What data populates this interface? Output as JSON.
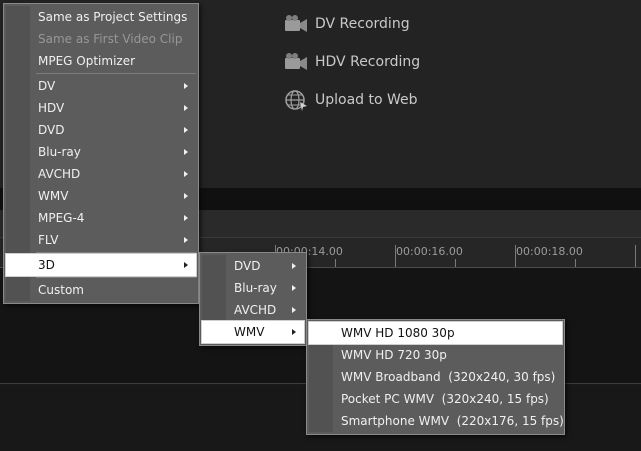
{
  "share_panel": {
    "items": [
      {
        "label": "DV Recording",
        "icon": "camcorder-icon"
      },
      {
        "label": "HDV Recording",
        "icon": "camcorder-icon"
      },
      {
        "label": "Upload to Web",
        "icon": "globe-icon"
      }
    ]
  },
  "ruler": {
    "labels": [
      "00:00:14.00",
      "00:00:16.00",
      "00:00:18.00"
    ]
  },
  "main_menu": {
    "items": [
      {
        "label": "Same as Project Settings",
        "enabled": true,
        "submenu": false
      },
      {
        "label": "Same as First Video Clip",
        "enabled": false,
        "submenu": false
      },
      {
        "label": "MPEG Optimizer",
        "enabled": true,
        "submenu": false
      },
      {
        "label": "DV",
        "enabled": true,
        "submenu": true
      },
      {
        "label": "HDV",
        "enabled": true,
        "submenu": true
      },
      {
        "label": "DVD",
        "enabled": true,
        "submenu": true
      },
      {
        "label": "Blu-ray",
        "enabled": true,
        "submenu": true
      },
      {
        "label": "AVCHD",
        "enabled": true,
        "submenu": true
      },
      {
        "label": "WMV",
        "enabled": true,
        "submenu": true
      },
      {
        "label": "MPEG-4",
        "enabled": true,
        "submenu": true
      },
      {
        "label": "FLV",
        "enabled": true,
        "submenu": true
      },
      {
        "label": "3D",
        "enabled": true,
        "submenu": true,
        "selected": true
      },
      {
        "label": "Custom",
        "enabled": true,
        "submenu": false
      }
    ]
  },
  "submenu_3d": {
    "items": [
      {
        "label": "DVD",
        "submenu": true
      },
      {
        "label": "Blu-ray",
        "submenu": true
      },
      {
        "label": "AVCHD",
        "submenu": true
      },
      {
        "label": "WMV",
        "submenu": true,
        "selected": true
      }
    ]
  },
  "submenu_wmv": {
    "items": [
      {
        "label": "WMV HD 1080 30p",
        "selected": true
      },
      {
        "label": "WMV HD 720 30p"
      },
      {
        "label": "WMV Broadband  (320x240, 30 fps)"
      },
      {
        "label": "Pocket PC WMV  (320x240, 15 fps)"
      },
      {
        "label": "Smartphone WMV  (220x176, 15 fps)"
      }
    ]
  }
}
